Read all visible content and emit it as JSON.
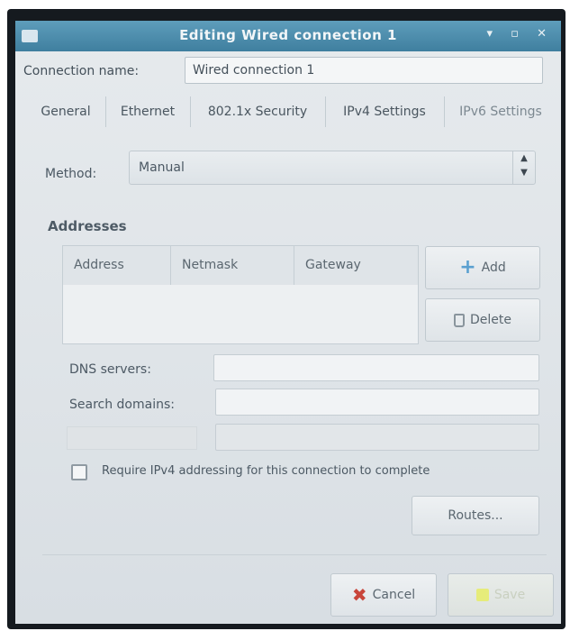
{
  "window": {
    "title": "Editing Wired connection 1",
    "controls": "▾ ▫ ✕"
  },
  "connection": {
    "label": "Connection name:",
    "value": "Wired connection 1"
  },
  "tabs": [
    {
      "label": "General"
    },
    {
      "label": "Ethernet"
    },
    {
      "label": "802.1x Security"
    },
    {
      "label": "IPv4 Settings"
    },
    {
      "label": "IPv6 Settings"
    }
  ],
  "method": {
    "label": "Method:",
    "value": "Manual"
  },
  "addresses": {
    "heading": "Addresses",
    "columns": [
      "Address",
      "Netmask",
      "Gateway"
    ],
    "rows": [],
    "add_label": "Add",
    "delete_label": "Delete"
  },
  "form": {
    "dns_label": "DNS servers:",
    "dns_value": "",
    "search_label": "Search domains:",
    "search_value": "",
    "dhcp_value": ""
  },
  "require": {
    "label": "Require IPv4 addressing for this connection to complete",
    "checked": false
  },
  "buttons": {
    "routes": "Routes...",
    "cancel": "Cancel",
    "save": "Save"
  },
  "colors": {
    "titlebar": "#4a8aaa",
    "cancel_icon": "#c8453a",
    "add_icon": "#5aa0d0"
  }
}
